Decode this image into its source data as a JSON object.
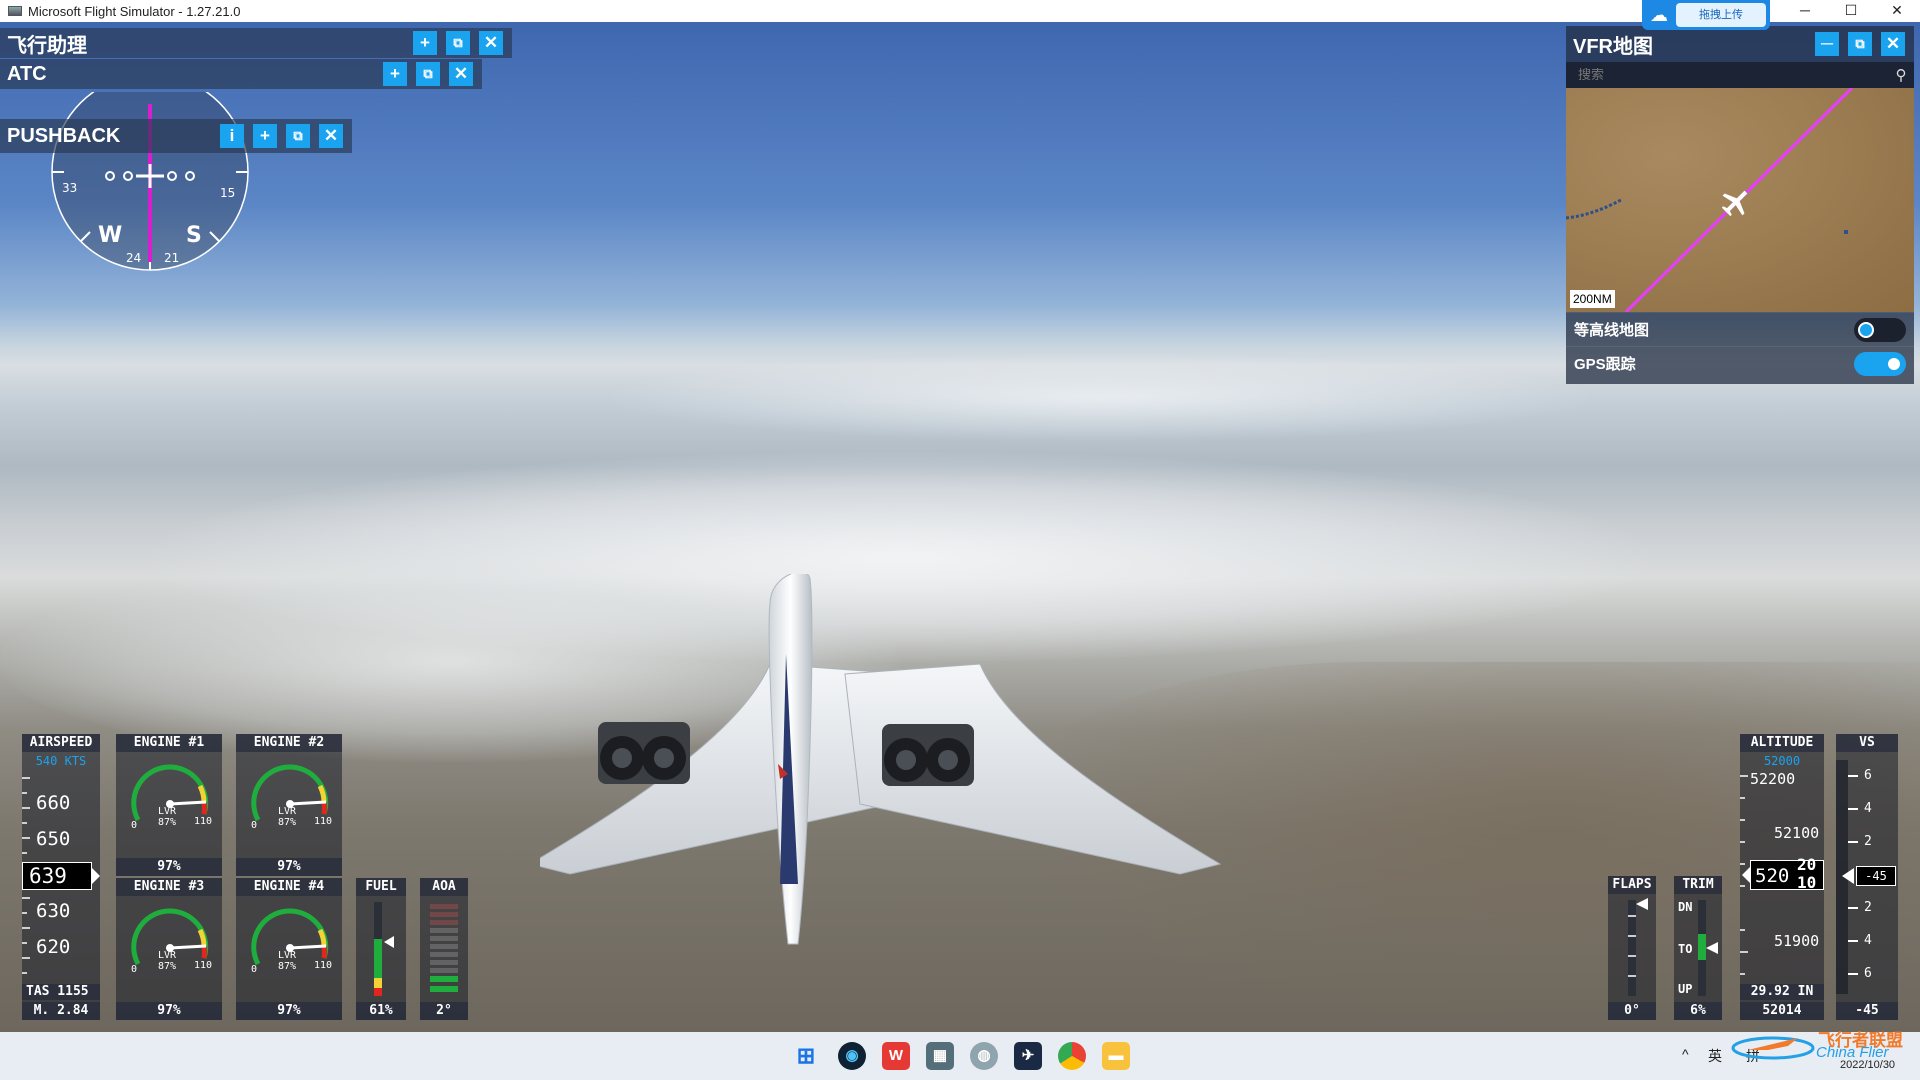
{
  "window": {
    "title": "Microsoft Flight Simulator - 1.27.21.0",
    "minimize": "─",
    "maximize": "☐",
    "close": "✕"
  },
  "upload_widget": {
    "label": "拖拽上传"
  },
  "panels": {
    "flight_assist": {
      "title": "飞行助理",
      "add": "+",
      "undock": "⧉",
      "close": "✕"
    },
    "atc": {
      "title": "ATC",
      "add": "+",
      "undock": "⧉",
      "close": "✕"
    },
    "pushback": {
      "title": "PUSHBACK",
      "info": "i",
      "add": "+",
      "undock": "⧉",
      "close": "✕"
    }
  },
  "compass": {
    "labels": [
      "W",
      "S",
      "33",
      "15",
      "24",
      "21"
    ]
  },
  "vfr_map": {
    "title": "VFR地图",
    "minimize": "─",
    "undock": "⧉",
    "close": "✕",
    "search_placeholder": "搜索",
    "scale": "200NM",
    "options": [
      {
        "label": "等高线地图",
        "enabled": false
      },
      {
        "label": "GPS跟踪",
        "enabled": true
      }
    ]
  },
  "instruments": {
    "airspeed": {
      "title": "AIRSPEED",
      "selected": "540 KTS",
      "tape": [
        "660",
        "650",
        "630",
        "620"
      ],
      "current": "639",
      "tas": "TAS 1155",
      "mach": "M. 2.84"
    },
    "engines": [
      {
        "title": "ENGINE #1",
        "min": "0",
        "max": "110",
        "lvr": "LVR",
        "lvr_pct": "87%",
        "n1": "97%"
      },
      {
        "title": "ENGINE #2",
        "min": "0",
        "max": "110",
        "lvr": "LVR",
        "lvr_pct": "87%",
        "n1": "97%"
      },
      {
        "title": "ENGINE #3",
        "min": "0",
        "max": "110",
        "lvr": "LVR",
        "lvr_pct": "87%",
        "n1": "97%"
      },
      {
        "title": "ENGINE #4",
        "min": "0",
        "max": "110",
        "lvr": "LVR",
        "lvr_pct": "87%",
        "n1": "97%"
      }
    ],
    "fuel": {
      "title": "FUEL",
      "value": "61%",
      "level": 0.61
    },
    "aoa": {
      "title": "AOA",
      "value": "2°"
    },
    "flaps": {
      "title": "FLAPS",
      "value": "0°"
    },
    "trim": {
      "title": "TRIM",
      "dn": "DN",
      "to": "TO",
      "up": "UP",
      "value": "6%"
    },
    "altitude": {
      "title": "ALTITUDE",
      "selected": "52000",
      "tape": [
        "52200",
        "52100",
        "51900"
      ],
      "current_main": "520",
      "current_roll_top": "20",
      "current_roll_bottom": "10",
      "baro": "29.92 IN",
      "bottom": "52014"
    },
    "vs": {
      "title": "VS",
      "tape": [
        "6",
        "4",
        "2",
        "2",
        "4",
        "6"
      ],
      "current": "-45",
      "value": "-45"
    }
  },
  "taskbar": {
    "tray_ime": "英",
    "tray_pinyin": "拼",
    "date": "2022/10/30"
  },
  "watermark": {
    "cn": "飞行者联盟",
    "en": "China Flier"
  }
}
